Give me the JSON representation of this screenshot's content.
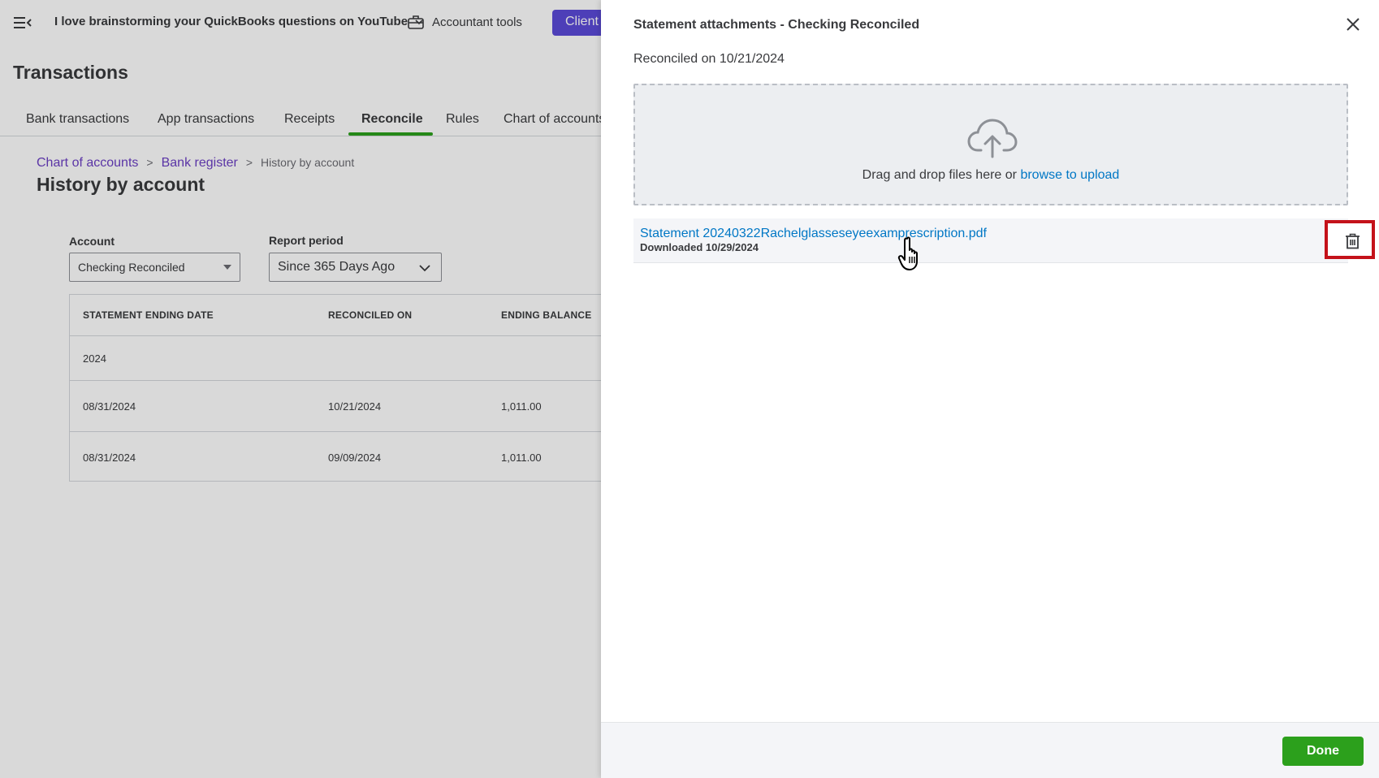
{
  "header": {
    "company_name": "I love brainstorming your QuickBooks questions on YouTube",
    "accountant_tools": "Accountant tools",
    "client_button": "Client"
  },
  "page": {
    "title": "Transactions",
    "tabs": [
      {
        "label": "Bank transactions"
      },
      {
        "label": "App transactions"
      },
      {
        "label": "Receipts"
      },
      {
        "label": "Reconcile",
        "active": true
      },
      {
        "label": "Rules"
      },
      {
        "label": "Chart of accounts"
      }
    ]
  },
  "breadcrumb": {
    "item1": "Chart of accounts",
    "item2": "Bank register",
    "current": "History by account",
    "separator": ">"
  },
  "history": {
    "title": "History by account",
    "account_label": "Account",
    "account_value": "Checking Reconciled",
    "period_label": "Report period",
    "period_value": "Since 365 Days Ago",
    "columns": [
      "STATEMENT ENDING DATE",
      "RECONCILED ON",
      "ENDING BALANCE"
    ],
    "group": "2024",
    "rows": [
      {
        "ending_date": "08/31/2024",
        "reconciled_on": "10/21/2024",
        "balance": "1,011.00"
      },
      {
        "ending_date": "08/31/2024",
        "reconciled_on": "09/09/2024",
        "balance": "1,011.00"
      }
    ]
  },
  "drawer": {
    "title": "Statement attachments - Checking Reconciled",
    "reconciled_on": "Reconciled on 10/21/2024",
    "drop_text": "Drag and drop files here or ",
    "browse_link": "browse to upload",
    "file": {
      "name": "Statement 20240322Rachelglasseseyeexamprescription.pdf",
      "meta": "Downloaded 10/29/2024"
    },
    "done_label": "Done"
  },
  "colors": {
    "accent_green": "#2ca01c",
    "link_blue": "#0077c5",
    "highlight_red": "#c4121a",
    "client_purple": "#5b4bd9"
  }
}
